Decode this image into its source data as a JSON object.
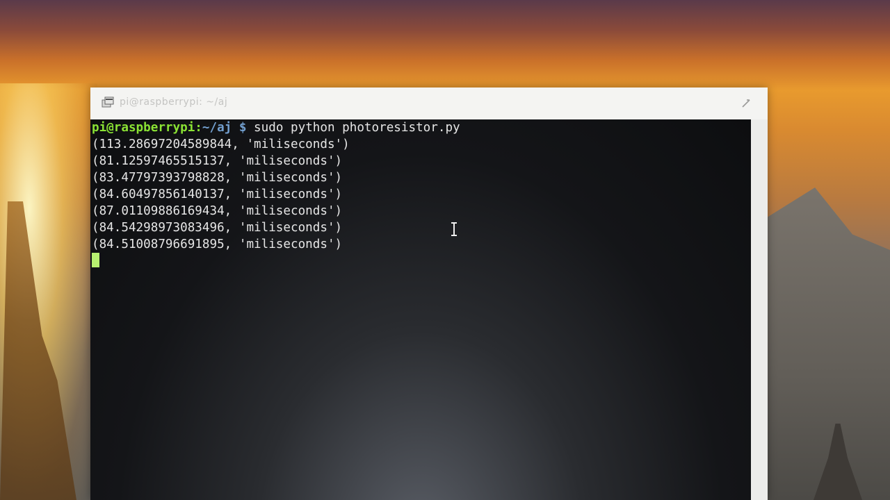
{
  "window": {
    "title": "pi@raspberrypi: ~/aj"
  },
  "terminal": {
    "prompt_user_host": "pi@raspberrypi",
    "prompt_sep": ":",
    "prompt_path": "~/aj",
    "prompt_symbol": " $",
    "command": " sudo python photoresistor.py",
    "output_lines": [
      "(113.28697204589844, 'miliseconds')",
      "(81.12597465515137, 'miliseconds')",
      "(83.47797393798828, 'miliseconds')",
      "(84.60497856140137, 'miliseconds')",
      "(87.01109886169434, 'miliseconds')",
      "(84.54298973083496, 'miliseconds')",
      "(84.51008796691895, 'miliseconds')"
    ]
  },
  "colors": {
    "prompt_user": "#8ae234",
    "prompt_path": "#729fcf",
    "cursor": "#b8f070"
  },
  "icons": {
    "title": "terminal-icon",
    "close": "close-icon",
    "mouse": "ibeam-cursor-icon"
  }
}
